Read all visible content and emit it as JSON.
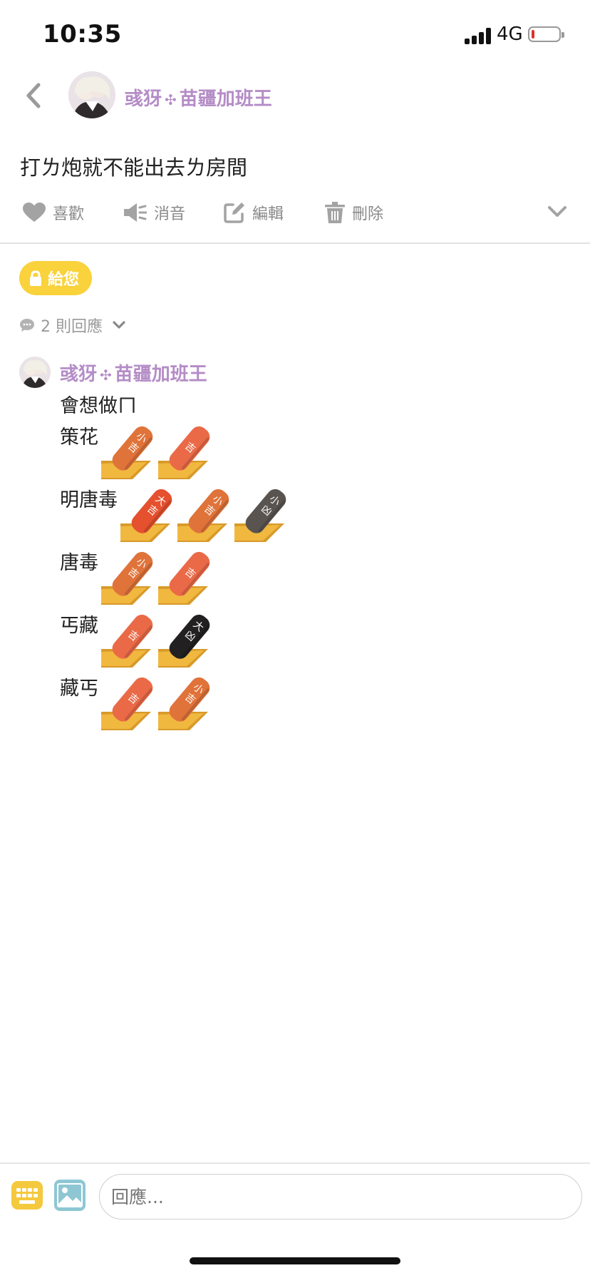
{
  "status_bar": {
    "time": "10:35",
    "network": "4G",
    "battery_level": 0.1
  },
  "post": {
    "author": {
      "name_part1": "彧犽",
      "separator": "✣",
      "name_part2": "苗疆加班王"
    },
    "title": "打ㄌ炮就不能出去ㄌ房間"
  },
  "actions": {
    "like": "喜歡",
    "mute": "消音",
    "edit": "編輯",
    "delete": "刪除"
  },
  "lock_badge": "給您",
  "replies": {
    "count_label": "2 則回應",
    "items": [
      {
        "author": {
          "name_part1": "彧犽",
          "separator": "✣",
          "name_part2": "苗疆加班王"
        },
        "intro": "會想做ㄇ",
        "lines": [
          {
            "label": "策花",
            "sticks": [
              {
                "top": "小",
                "bottom": "吉",
                "color": "#e0733a"
              },
              {
                "top": "",
                "bottom": "吉",
                "color": "#ea6a47"
              }
            ]
          },
          {
            "label": "明唐毒",
            "sticks": [
              {
                "top": "大",
                "bottom": "吉",
                "color": "#e5502e"
              },
              {
                "top": "小",
                "bottom": "吉",
                "color": "#e0733a"
              },
              {
                "top": "小",
                "bottom": "凶",
                "color": "#595450"
              }
            ]
          },
          {
            "label": "唐毒",
            "sticks": [
              {
                "top": "小",
                "bottom": "吉",
                "color": "#e0733a"
              },
              {
                "top": "",
                "bottom": "吉",
                "color": "#ea6a47"
              }
            ]
          },
          {
            "label": "丐藏",
            "sticks": [
              {
                "top": "",
                "bottom": "吉",
                "color": "#ea6a47"
              },
              {
                "top": "大",
                "bottom": "凶",
                "color": "#222020"
              }
            ]
          },
          {
            "label": "藏丐",
            "sticks": [
              {
                "top": "",
                "bottom": "吉",
                "color": "#ea6a47"
              },
              {
                "top": "小",
                "bottom": "吉",
                "color": "#e0733a"
              }
            ]
          }
        ]
      }
    ]
  },
  "composer": {
    "placeholder": "回應..."
  },
  "colors": {
    "accent": "#b48cc6",
    "badge": "#f9d23c",
    "icon_gray": "#a3a3a3"
  },
  "icons": [
    "back-chevron-icon",
    "heart-icon",
    "speaker-mute-icon",
    "edit-icon",
    "trash-icon",
    "chevron-down-icon",
    "lock-icon",
    "comment-icon",
    "keyboard-icon",
    "image-icon"
  ]
}
